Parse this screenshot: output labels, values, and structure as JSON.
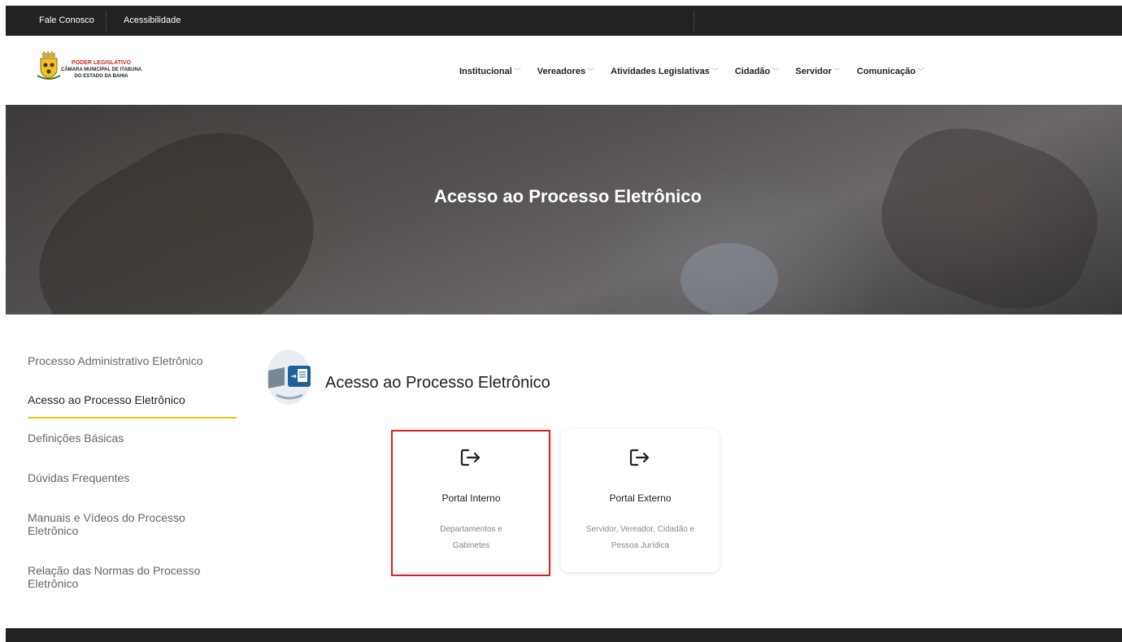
{
  "topbar": {
    "links": [
      "Fale Conosco",
      "Acessibilidade"
    ]
  },
  "logo": {
    "line1": "PODER LEGISLATIVO",
    "line2": "CÂMARA MUNICIPAL DE ITABUNA",
    "line3": "DO ESTADO DA BAHIA"
  },
  "nav": {
    "items": [
      {
        "label": "Institucional"
      },
      {
        "label": "Vereadores"
      },
      {
        "label": "Atividades Legislativas"
      },
      {
        "label": "Cidadão"
      },
      {
        "label": "Servidor"
      },
      {
        "label": "Comunicação"
      }
    ]
  },
  "banner": {
    "title": "Acesso ao Processo Eletrônico"
  },
  "sidebar": {
    "items": [
      {
        "label": "Processo Administrativo Eletrônico"
      },
      {
        "label": "Acesso ao Processo Eletrônico"
      },
      {
        "label": "Definições Básicas"
      },
      {
        "label": "Dúvidas Frequentes"
      },
      {
        "label": "Manuais e Vídeos do Processo Eletrônico"
      },
      {
        "label": "Relação das Normas do Processo Eletrônico"
      }
    ],
    "active_index": 1
  },
  "main": {
    "section_title": "Acesso ao Processo Eletrônico",
    "cards": [
      {
        "title": "Portal Interno",
        "desc_line1": "Departamentos e",
        "desc_line2": "Gabinetes",
        "icon": "logout-icon"
      },
      {
        "title": "Portal Externo",
        "desc_line1": "Servidor, Vereador, Cidadão e",
        "desc_line2": "Pessoa Jurídica",
        "icon": "logout-icon"
      }
    ]
  },
  "colors": {
    "topbar": "#222222",
    "accent": "#f2c31b",
    "highlight": "#e02020"
  }
}
